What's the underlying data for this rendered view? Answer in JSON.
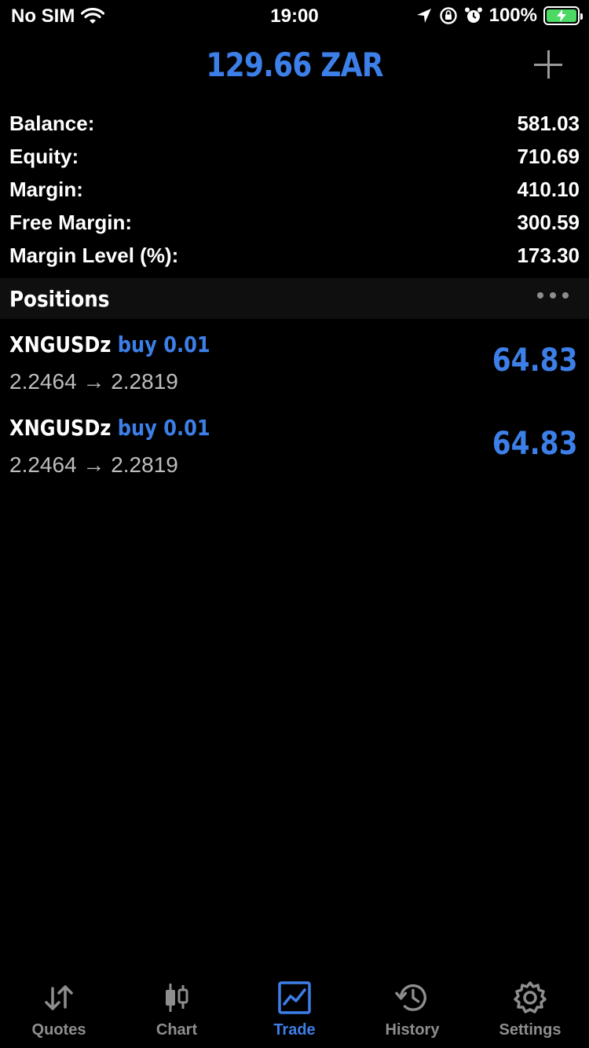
{
  "status_bar": {
    "carrier": "No SIM",
    "time": "19:00",
    "battery": "100%"
  },
  "header": {
    "title": "129.66 ZAR"
  },
  "summary": [
    {
      "label": "Balance:",
      "value": "581.03"
    },
    {
      "label": "Equity:",
      "value": "710.69"
    },
    {
      "label": "Margin:",
      "value": "410.10"
    },
    {
      "label": "Free Margin:",
      "value": "300.59"
    },
    {
      "label": "Margin Level (%):",
      "value": "173.30"
    }
  ],
  "positions": {
    "title": "Positions",
    "items": [
      {
        "symbol": "XNGUSDz",
        "side": "buy 0.01",
        "prices": "2.2464 → 2.2819",
        "profit": "64.83"
      },
      {
        "symbol": "XNGUSDz",
        "side": "buy 0.01",
        "prices": "2.2464 → 2.2819",
        "profit": "64.83"
      }
    ]
  },
  "tabs": [
    {
      "label": "Quotes",
      "icon": "quotes-arrows-icon"
    },
    {
      "label": "Chart",
      "icon": "candlestick-icon"
    },
    {
      "label": "Trade",
      "icon": "trade-chart-icon",
      "active": true
    },
    {
      "label": "History",
      "icon": "history-clock-icon"
    },
    {
      "label": "Settings",
      "icon": "gear-icon"
    }
  ],
  "colors": {
    "accent": "#3d7fe8",
    "inactive": "#8e8e8e",
    "background": "#000000",
    "battery_fill": "#4cd964"
  }
}
